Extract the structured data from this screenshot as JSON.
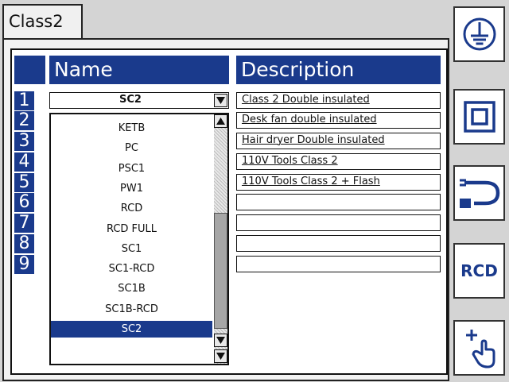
{
  "tab": {
    "label": "Class2"
  },
  "table": {
    "headers": {
      "name": "Name",
      "description": "Description"
    },
    "rows": [
      {
        "num": "1",
        "description": "Class 2 Double insulated"
      },
      {
        "num": "2",
        "description": "Desk fan double insulated"
      },
      {
        "num": "3",
        "description": "Hair dryer Double insulated"
      },
      {
        "num": "4",
        "description": "110V Tools Class 2"
      },
      {
        "num": "5",
        "description": "110V Tools Class 2 + Flash"
      },
      {
        "num": "6",
        "description": ""
      },
      {
        "num": "7",
        "description": ""
      },
      {
        "num": "8",
        "description": ""
      },
      {
        "num": "9",
        "description": ""
      }
    ]
  },
  "name_combo": {
    "value": "SC2"
  },
  "dropdown": {
    "items": [
      "KETB",
      "PC",
      "PSC1",
      "PW1",
      "RCD",
      "RCD FULL",
      "SC1",
      "SC1-RCD",
      "SC1B",
      "SC1B-RCD",
      "SC2"
    ],
    "selected": "SC2"
  },
  "side_buttons": [
    {
      "icon": "earth-ground-icon"
    },
    {
      "icon": "double-insulation-icon"
    },
    {
      "icon": "power-plug-icon"
    },
    {
      "label": "RCD"
    },
    {
      "icon": "touch-hand-icon"
    }
  ],
  "colors": {
    "accent": "#1a3a8c",
    "background": "#d4d4d4"
  }
}
